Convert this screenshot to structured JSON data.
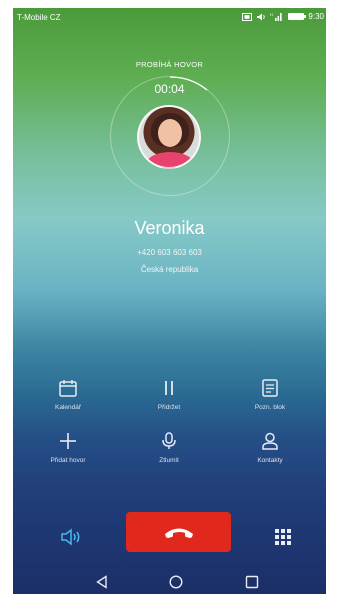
{
  "status_bar": {
    "carrier": "T-Mobile CZ",
    "time": "9:30",
    "icons": [
      "sim-icon",
      "speaker-status-icon",
      "signal-icon",
      "battery-icon"
    ]
  },
  "call": {
    "status": "PROBÍHÁ HOVOR",
    "timer": "00:04",
    "caller_name": "Veronika",
    "caller_number": "+420 603 603 603",
    "caller_country": "Česká republika"
  },
  "actions": [
    {
      "label": "Kalendář",
      "icon": "calendar-icon"
    },
    {
      "label": "Přidržet",
      "icon": "pause-icon"
    },
    {
      "label": "Pozn. blok",
      "icon": "notepad-icon"
    },
    {
      "label": "Přidat hovor",
      "icon": "plus-icon"
    },
    {
      "label": "Ztlumit",
      "icon": "microphone-icon"
    },
    {
      "label": "Kontakty",
      "icon": "contact-icon"
    }
  ],
  "bottom_controls": {
    "speaker": "speaker-icon",
    "end_call": "end-call-icon",
    "dialpad": "dialpad-icon"
  },
  "colors": {
    "end_call": "#e0281d",
    "speaker_active": "#49b9ea"
  }
}
